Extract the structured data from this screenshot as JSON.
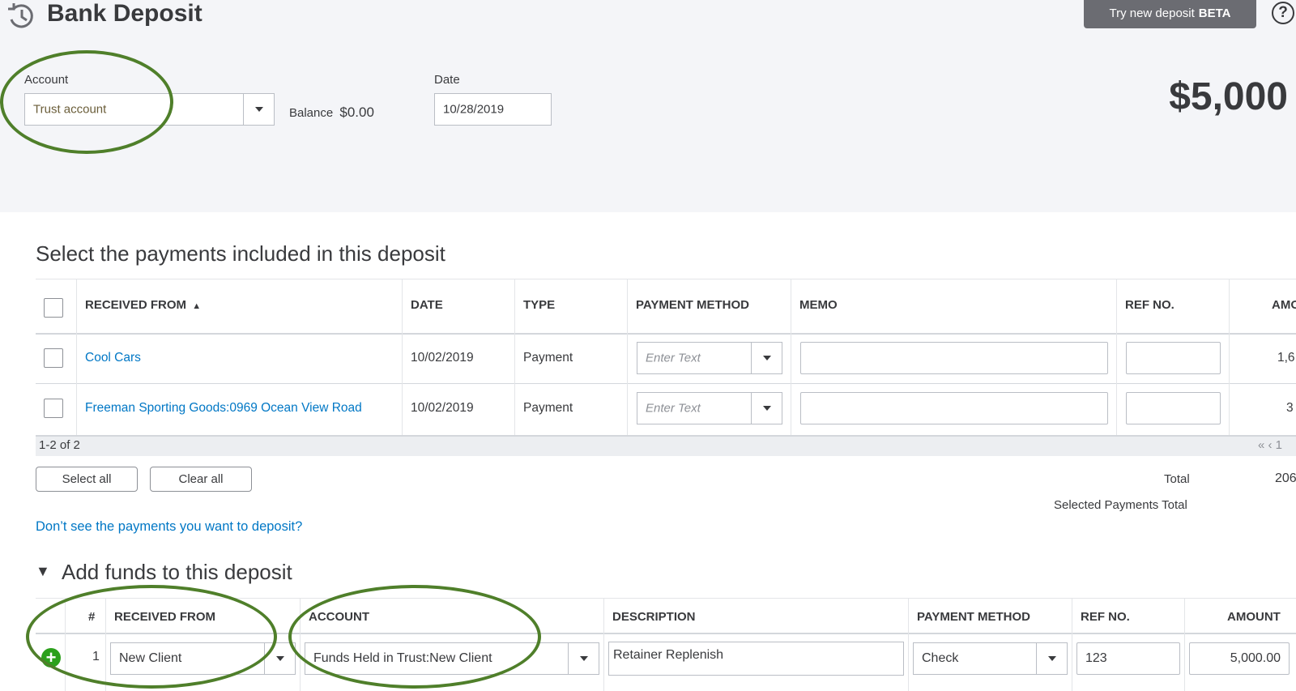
{
  "header": {
    "title": "Bank Deposit",
    "try_button": "Try new deposit",
    "try_button_badge": "BETA",
    "help": "?",
    "account_label": "Account",
    "account_value": "Trust account",
    "balance_label": "Balance",
    "balance_value": "$0.00",
    "date_label": "Date",
    "date_value": "10/28/2019",
    "amount": "$5,000"
  },
  "payments": {
    "title": "Select the payments included in this deposit",
    "columns": [
      "RECEIVED FROM",
      "DATE",
      "TYPE",
      "PAYMENT METHOD",
      "MEMO",
      "REF NO.",
      "AMO"
    ],
    "rows": [
      {
        "received_from": "Cool Cars",
        "date": "10/02/2019",
        "type": "Payment",
        "method_placeholder": "Enter Text",
        "amount": "1,6"
      },
      {
        "received_from": "Freeman Sporting Goods:0969 Ocean View Road",
        "date": "10/02/2019",
        "type": "Payment",
        "method_placeholder": "Enter Text",
        "amount": "3"
      }
    ],
    "pager": "1-2 of 2",
    "pager_controls": "« ‹ 1",
    "select_all": "Select all",
    "clear_all": "Clear all",
    "total_label": "Total",
    "total_value": "206",
    "selected_total_label": "Selected Payments Total",
    "missing_link": "Don’t see the payments you want to deposit?"
  },
  "funds": {
    "title": "Add funds to this deposit",
    "columns": [
      "#",
      "RECEIVED FROM",
      "ACCOUNT",
      "DESCRIPTION",
      "PAYMENT METHOD",
      "REF NO.",
      "AMOUNT"
    ],
    "rows": [
      {
        "num": "1",
        "received_from": "New Client",
        "account": "Funds Held in Trust:New Client",
        "description": "Retainer Replenish",
        "payment_method": "Check",
        "ref_no": "123",
        "amount": "5,000.00"
      }
    ]
  },
  "colors": {
    "accent": "#4f7f2a",
    "link": "#0077c5",
    "add": "#2ca01c"
  }
}
